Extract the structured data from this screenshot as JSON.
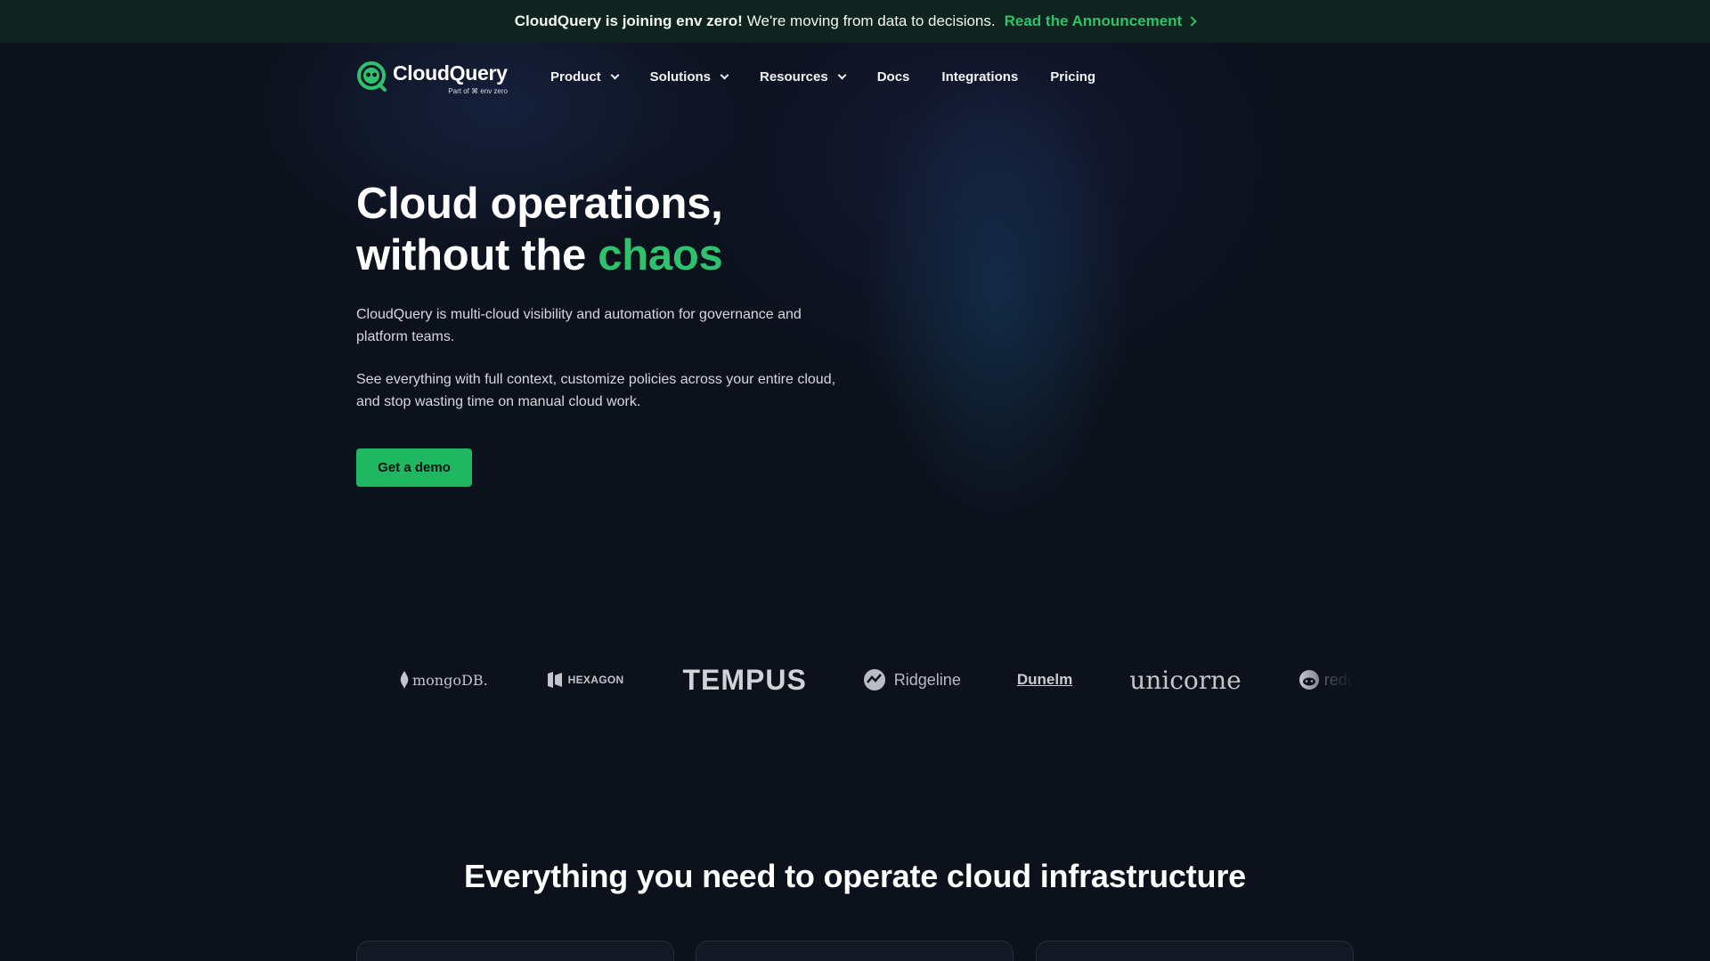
{
  "announcement": {
    "strong": "CloudQuery is joining env zero!",
    "text": "We're moving from data to decisions.",
    "link": "Read the Announcement"
  },
  "nav": {
    "logo_text": "CloudQuery",
    "logo_sub": "Part of ⌘ env zero",
    "items": [
      {
        "label": "Product",
        "dropdown": true
      },
      {
        "label": "Solutions",
        "dropdown": true
      },
      {
        "label": "Resources",
        "dropdown": true
      },
      {
        "label": "Docs",
        "dropdown": false
      },
      {
        "label": "Integrations",
        "dropdown": false
      },
      {
        "label": "Pricing",
        "dropdown": false
      }
    ]
  },
  "hero": {
    "title_line1": "Cloud operations,",
    "title_line2_prefix": "without the ",
    "title_accent": "chaos",
    "paragraph1": "CloudQuery is multi-cloud visibility and automation for governance and platform teams.",
    "paragraph2": "See everything with full context, customize policies across your entire cloud, and stop wasting time on manual cloud work.",
    "cta_label": "Get a demo"
  },
  "logos": {
    "mongodb": "mongoDB.",
    "hexagon": "HEXAGON",
    "tempus": "TEMPUS",
    "ridgeline": "Ridgeline",
    "dunelm": "Dunelm",
    "unicorne": "unicorne",
    "reddit": "reddit"
  },
  "section": {
    "title": "Everything you need to operate cloud infrastructure"
  },
  "colors": {
    "accent": "#2dc26b",
    "background": "#0c111b",
    "announcement_bg": "#0f231f",
    "cta_bg": "#1fb761"
  }
}
